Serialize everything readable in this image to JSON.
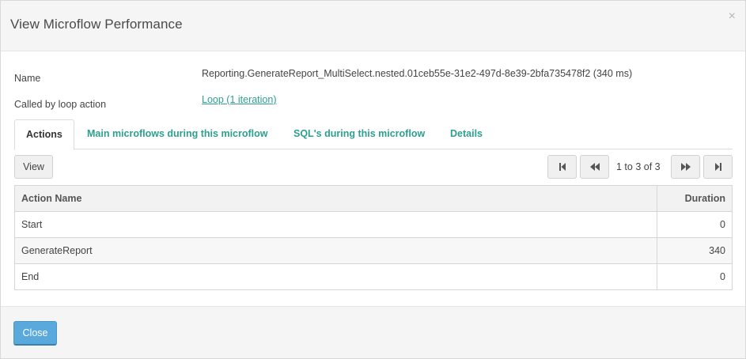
{
  "dialog": {
    "title": "View Microflow Performance",
    "close_glyph": "×"
  },
  "fields": {
    "name_label": "Name",
    "name_value": "Reporting.GenerateReport_MultiSelect.nested.01ceb55e-31e2-497d-8e39-2bfa735478f2 (340 ms)",
    "called_by_label": "Called by loop action",
    "called_by_value": "Loop (1 iteration)"
  },
  "tabs": [
    {
      "label": "Actions",
      "active": true
    },
    {
      "label": "Main microflows during this microflow",
      "active": false
    },
    {
      "label": "SQL's during this microflow",
      "active": false
    },
    {
      "label": "Details",
      "active": false
    }
  ],
  "toolbar": {
    "view_label": "View"
  },
  "pager": {
    "text": "1 to 3 of 3",
    "icons": [
      "first-page-icon",
      "previous-page-icon",
      "next-page-icon",
      "last-page-icon"
    ]
  },
  "grid": {
    "columns": [
      "Action Name",
      "Duration"
    ],
    "rows": [
      {
        "name": "Start",
        "duration": "0"
      },
      {
        "name": "GenerateReport",
        "duration": "340"
      },
      {
        "name": "End",
        "duration": "0"
      }
    ]
  },
  "footer": {
    "close_label": "Close"
  },
  "colors": {
    "link": "#2e9f8f",
    "primary_button": "#5aa9dd"
  }
}
